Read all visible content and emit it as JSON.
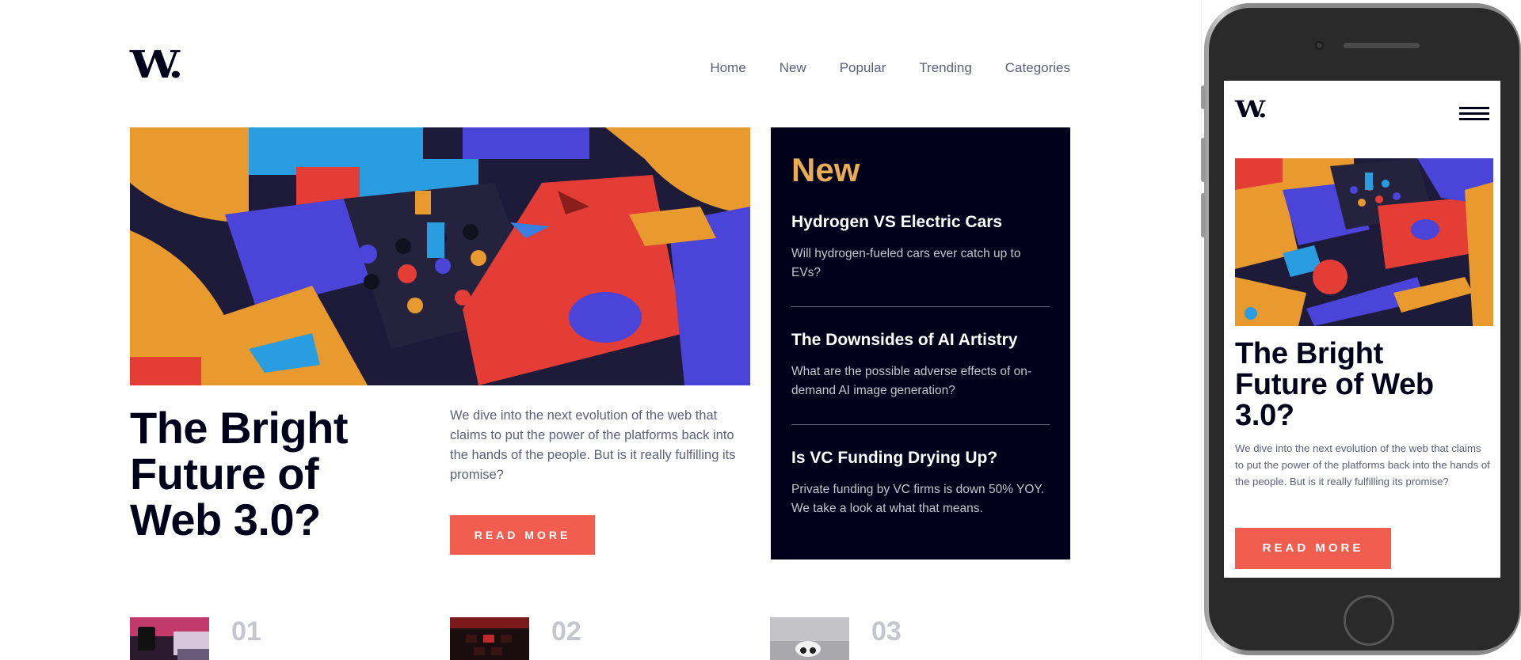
{
  "brand": {
    "logo_text": "W."
  },
  "nav": {
    "items": [
      "Home",
      "New",
      "Popular",
      "Trending",
      "Categories"
    ]
  },
  "hero": {
    "title": "The Bright Future of Web 3.0?",
    "description": "We dive into the next evolution of the web that claims to put the power of the platforms back into the hands of the people. But is it really fulfilling its promise?",
    "button_label": "READ MORE",
    "image_icon": "abstract-3d-blocks-image"
  },
  "new_panel": {
    "title": "New",
    "items": [
      {
        "title": "Hydrogen VS Electric Cars",
        "text": "Will hydrogen-fueled cars ever catch up to EVs?"
      },
      {
        "title": "The Downsides of AI Artistry",
        "text": "What are the possible adverse effects of on-demand AI image generation?"
      },
      {
        "title": "Is VC Funding Drying Up?",
        "text": "Private funding by VC firms is down 50% YOY. We take a look at what that means."
      }
    ]
  },
  "ranked": {
    "items": [
      {
        "number": "01",
        "thumb": "retro-pc-image"
      },
      {
        "number": "02",
        "thumb": "keyboard-image"
      },
      {
        "number": "03",
        "thumb": "gaming-controller-image"
      }
    ]
  },
  "mobile": {
    "logo_text": "W.",
    "menu_icon": "hamburger-icon",
    "title": "The Bright Future of Web 3.0?",
    "description": "We dive into the next evolution of the web that claims to put the power of the platforms back into the hands of the people. But is it really fulfilling its promise?",
    "button_label": "READ MORE"
  },
  "colors": {
    "accent": "#f15e50",
    "gold": "#e9ab53",
    "dark": "#00001a",
    "grey": "#5d5f79",
    "light_grey": "#c5c6ce"
  }
}
